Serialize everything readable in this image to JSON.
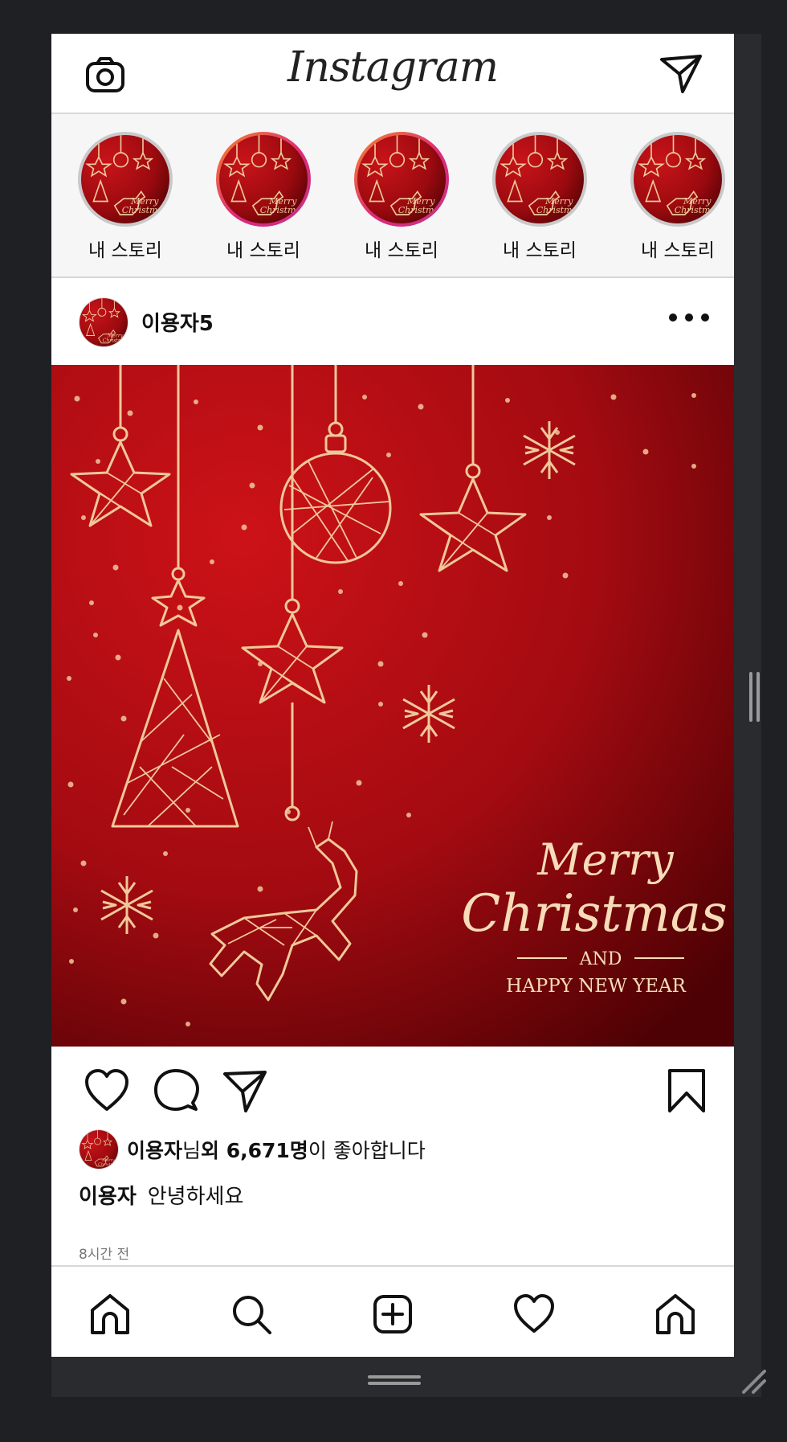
{
  "app": {
    "logo": "Instagram"
  },
  "stories": [
    {
      "label": "내 스토리",
      "ring": "seen"
    },
    {
      "label": "내 스토리",
      "ring": "new"
    },
    {
      "label": "내 스토리",
      "ring": "new"
    },
    {
      "label": "내 스토리",
      "ring": "seen"
    },
    {
      "label": "내 스토리",
      "ring": "seen"
    }
  ],
  "post": {
    "username": "이용자5",
    "image_text": {
      "line1": "Merry",
      "line2": "Christmas",
      "line3": "AND",
      "line4": "HAPPY NEW YEAR"
    },
    "likes": {
      "user": "이용자",
      "suffix1": "님 ",
      "count": "외 6,671명",
      "suffix2": "이 좋아합니다"
    },
    "caption": {
      "user": "이용자",
      "text": "안녕하세요"
    },
    "time": "8시간 전"
  },
  "icons": {
    "top": [
      "camera-icon",
      "direct-message-icon"
    ],
    "actions": [
      "heart-icon",
      "comment-icon",
      "share-icon",
      "bookmark-icon"
    ],
    "nav": [
      "home-icon",
      "search-icon",
      "add-post-icon",
      "activity-heart-icon",
      "profile-home-icon"
    ]
  },
  "colors": {
    "post_red": "#b30f14",
    "gold": "#f0c89a",
    "story_ring_gradient": [
      "#f58529",
      "#dd2a7b"
    ],
    "story_ring_seen": "#c9c9c9"
  }
}
